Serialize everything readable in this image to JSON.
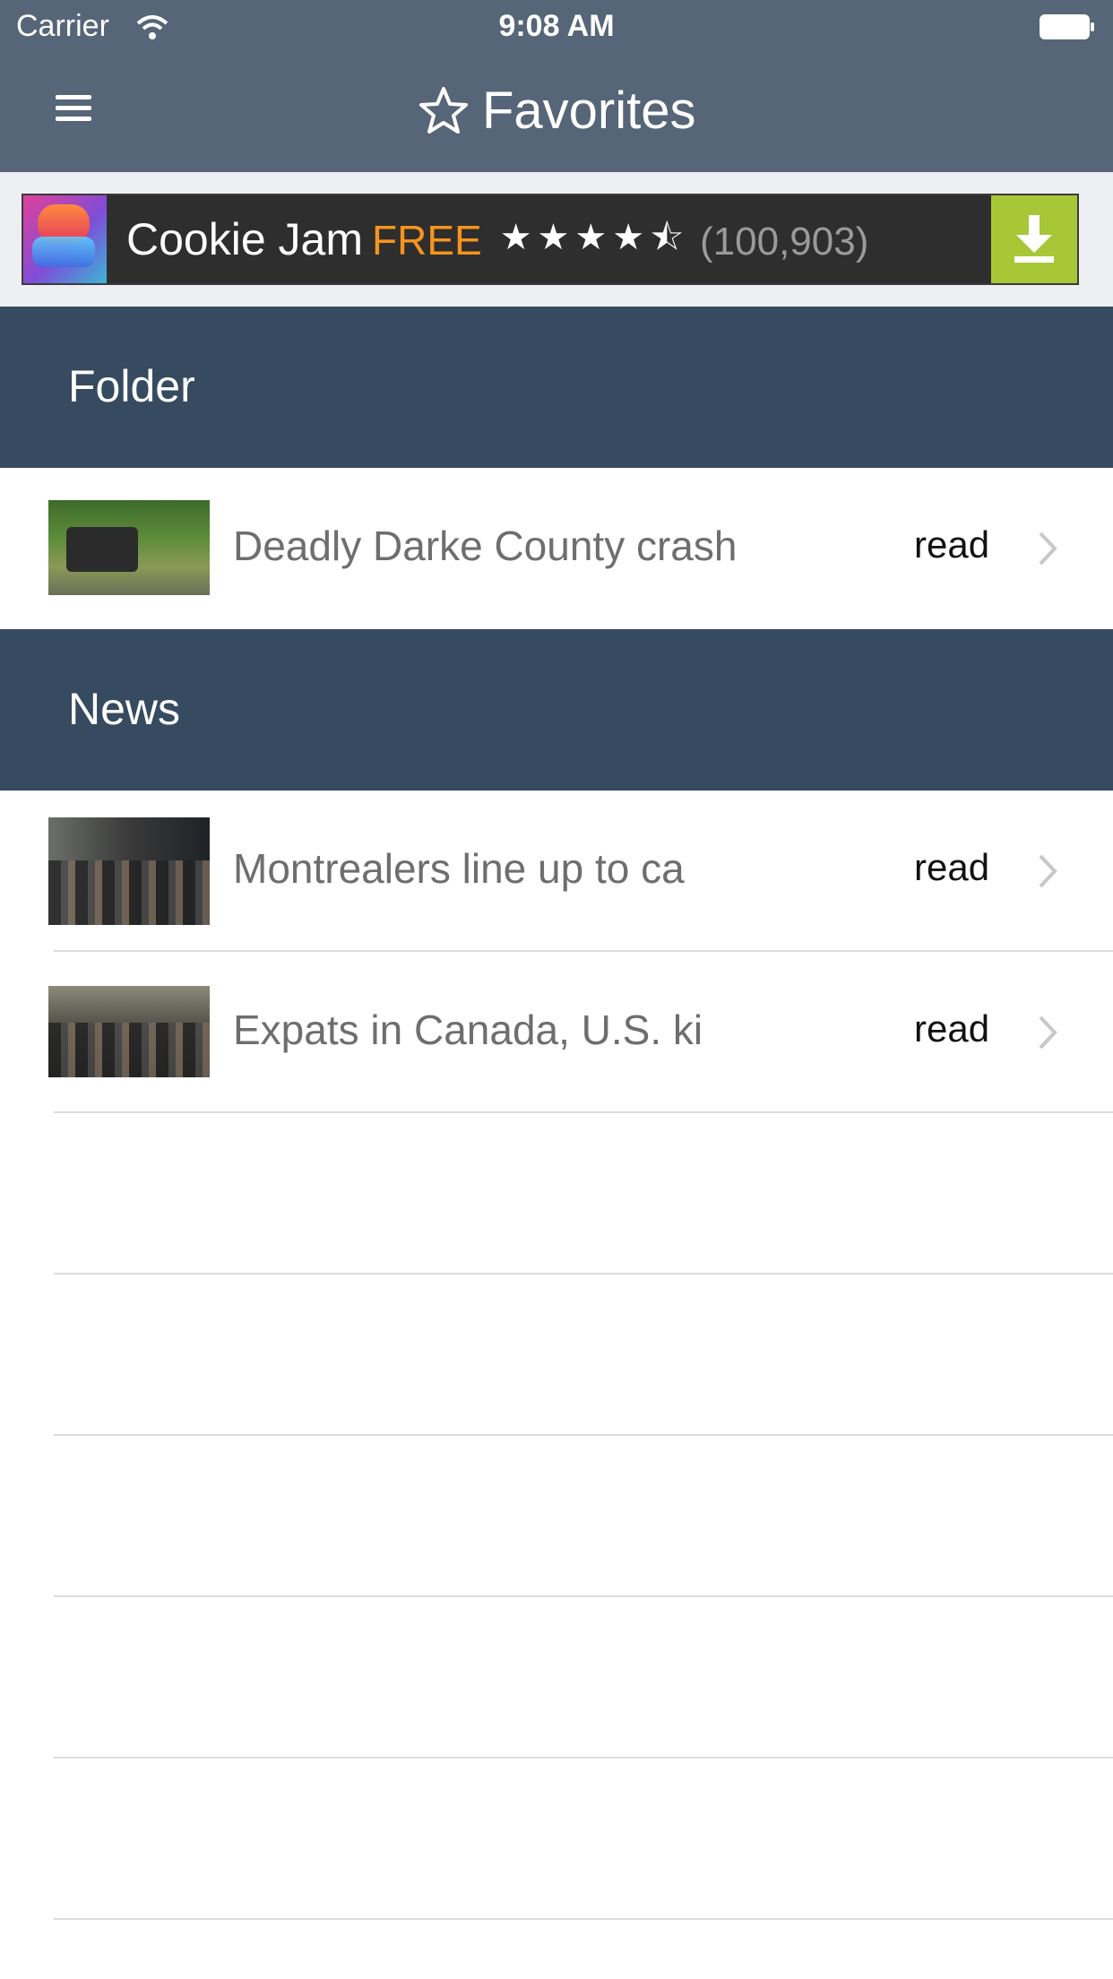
{
  "status_bar": {
    "carrier": "Carrier",
    "time": "9:08 AM"
  },
  "nav": {
    "title": "Favorites",
    "menu_icon": "hamburger-menu-icon",
    "title_icon": "star-outline-icon"
  },
  "ad": {
    "name": "Cookie Jam",
    "price": "FREE",
    "stars": "★★★★⯪",
    "rating": 4.5,
    "review_count": "(100,903)",
    "accent": "#a8c737",
    "icon": "download-icon"
  },
  "sections": [
    {
      "title": "Folder",
      "rows": [
        {
          "title": "Deadly Darke County crash",
          "action": "read"
        }
      ]
    },
    {
      "title": "News",
      "rows": [
        {
          "title": "Montrealers line up to ca",
          "action": "read"
        },
        {
          "title": "Expats in Canada, U.S. ki",
          "action": "read"
        }
      ]
    }
  ],
  "colors": {
    "nav_bg": "#566577",
    "section_bg": "#364a60",
    "free_text": "#f7941d"
  }
}
